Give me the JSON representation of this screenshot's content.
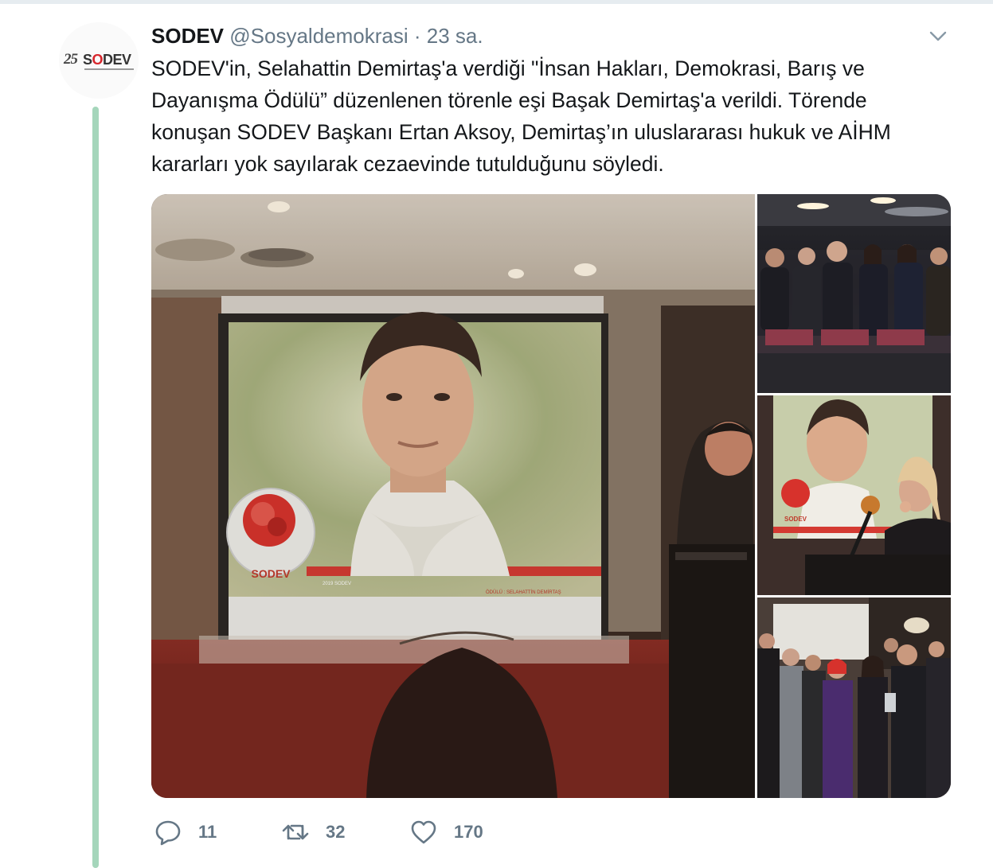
{
  "account": {
    "avatar_number": "25",
    "avatar_brand_pre": "S",
    "avatar_brand_o": "O",
    "avatar_brand_post": "DEV",
    "name": "SODEV",
    "handle": "@Sosyaldemokrasi",
    "separator": "·",
    "time": "23 sa."
  },
  "tweet": {
    "text": "SODEV'in, Selahattin Demirtaş'a verdiği \"İnsan Hakları, Demokrasi, Barış ve Dayanışma Ödülü” düzenlenen törenle eşi Başak Demirtaş'a verildi. Törende konuşan SODEV Başkanı Ertan Aksoy, Demirtaş’ın uluslararası hukuk ve AİHM kararları yok sayılarak cezaevinde tutulduğunu söyledi."
  },
  "media": {
    "screen_logo": "SODEV",
    "screen_caption_left": "2019 SODEV",
    "screen_caption_right": "ÖDÜLÜ : SELAHATTİN DEMİRTAŞ",
    "side_logo": "SODEV"
  },
  "actions": {
    "replies": "11",
    "retweets": "32",
    "likes": "170"
  },
  "colors": {
    "thread_line": "#a5d6bb",
    "secondary_text": "#657786",
    "primary_text": "#14171a"
  },
  "icons": [
    "chevron-down-icon",
    "reply-icon",
    "retweet-icon",
    "like-icon"
  ]
}
